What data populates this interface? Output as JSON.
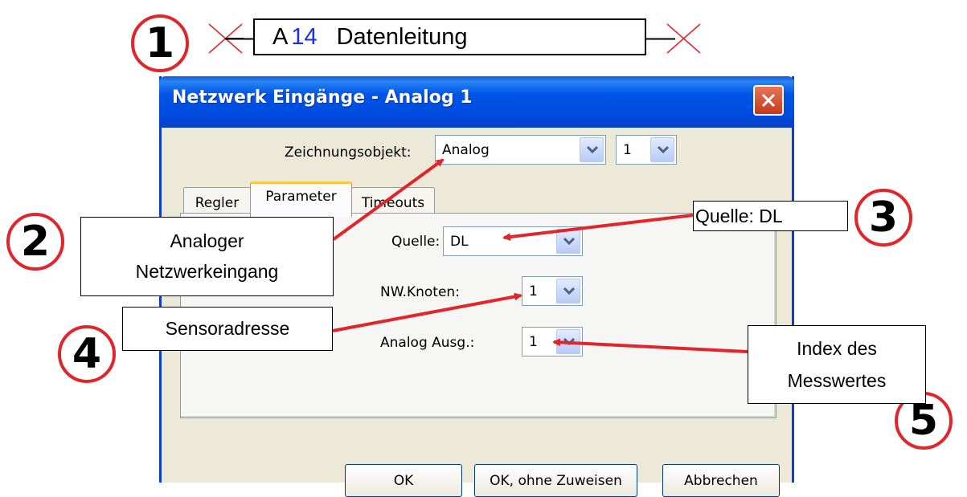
{
  "drawing_object": {
    "prefix": "A",
    "number": "14",
    "name": "Datenleitung"
  },
  "dialog": {
    "title": "Netzwerk Eingänge - Analog 1",
    "drawing_object_label": "Zeichnungsobjekt:",
    "drawing_object_value": "Analog",
    "drawing_object_index": "1",
    "tabs": [
      {
        "label": "Regler"
      },
      {
        "label": "Parameter"
      },
      {
        "label": "Timeouts"
      }
    ],
    "active_tab": "Parameter",
    "fields": {
      "source_label": "Quelle:",
      "source_value": "DL",
      "node_label": "NW.Knoten:",
      "node_value": "1",
      "output_label": "Analog Ausg.:",
      "output_value": "1"
    },
    "buttons": {
      "ok": "OK",
      "ok_no_assign": "OK, ohne Zuweisen",
      "cancel": "Abbrechen"
    }
  },
  "annotations": {
    "markers": [
      "1",
      "2",
      "3",
      "4",
      "5"
    ],
    "callout_2": {
      "line1": "Analoger",
      "line2": "Netzwerkeingang"
    },
    "callout_3": "Quelle: DL",
    "callout_4": "Sensoradresse",
    "callout_5": {
      "line1": "Index des",
      "line2": "Messwertes"
    },
    "accent_color": "#e0262a"
  }
}
